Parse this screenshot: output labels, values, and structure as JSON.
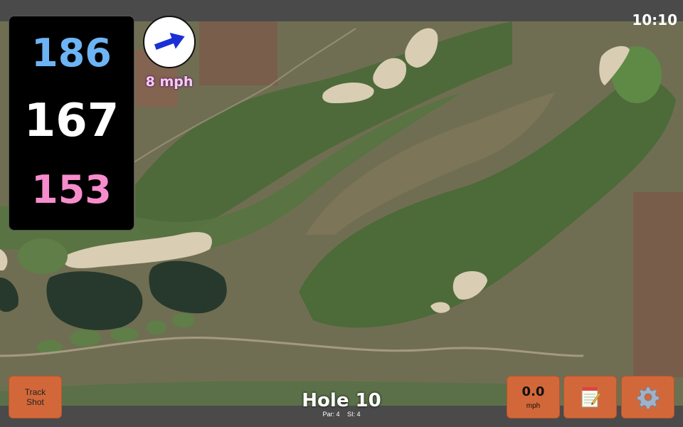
{
  "status": {
    "time": "10:10"
  },
  "distances": {
    "back": "186",
    "middle": "167",
    "front": "153"
  },
  "wind": {
    "speed_label": "8 mph",
    "direction_icon": "wind-arrow-icon"
  },
  "hole": {
    "title": "Hole 10",
    "par_label": "Par: 4",
    "si_label": "SI: 4"
  },
  "buttons": {
    "track_shot_line1": "Track",
    "track_shot_line2": "Shot",
    "speed_value": "0.0",
    "speed_unit": "mph",
    "notes_icon": "notepad-icon",
    "settings_icon": "gear-icon"
  },
  "colors": {
    "back": "#6db4f5",
    "middle": "#ffffff",
    "front": "#f78ccd",
    "button": "#d2683a",
    "wind_text": "#f0d0f0"
  }
}
